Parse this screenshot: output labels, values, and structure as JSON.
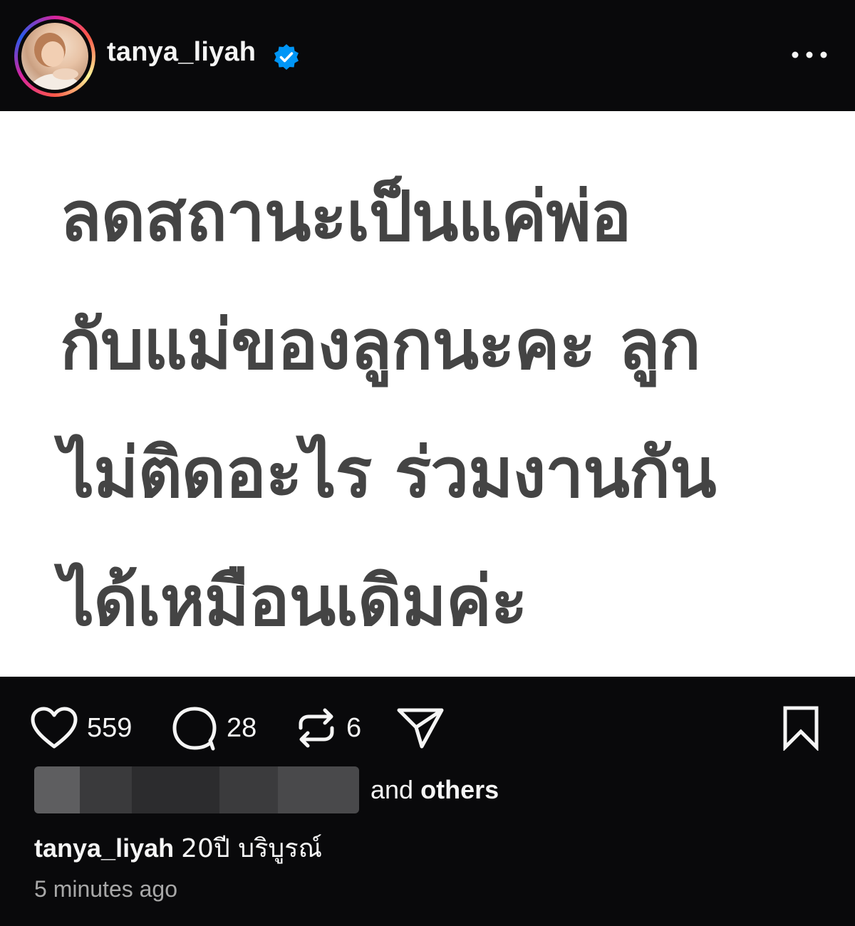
{
  "header": {
    "username": "tanya_liyah",
    "verified_icon": "verified-badge-icon",
    "more_icon": "more-options-icon"
  },
  "post": {
    "text": "ลดสถานะเป็นแค่พ่อ\nกับแม่ของลูกนะคะ ลูก\nไม่ติดอะไร ร่วมงานกัน\nได้เหมือนเดิมค่ะ"
  },
  "actions": {
    "like_count": "559",
    "comment_count": "28",
    "repost_count": "6",
    "icons": [
      "heart-icon",
      "comment-icon",
      "repost-icon",
      "share-icon",
      "bookmark-icon"
    ]
  },
  "likes": {
    "suffix_and": "and",
    "suffix_others": "others"
  },
  "caption": {
    "username": "tanya_liyah",
    "text": "20ปี บริบูรณ์"
  },
  "timestamp": "5 minutes ago",
  "colors": {
    "background": "#09090b",
    "post_background": "#ffffff",
    "post_text": "#444444",
    "verified": "#0095f6",
    "muted": "#a8a8a8"
  }
}
